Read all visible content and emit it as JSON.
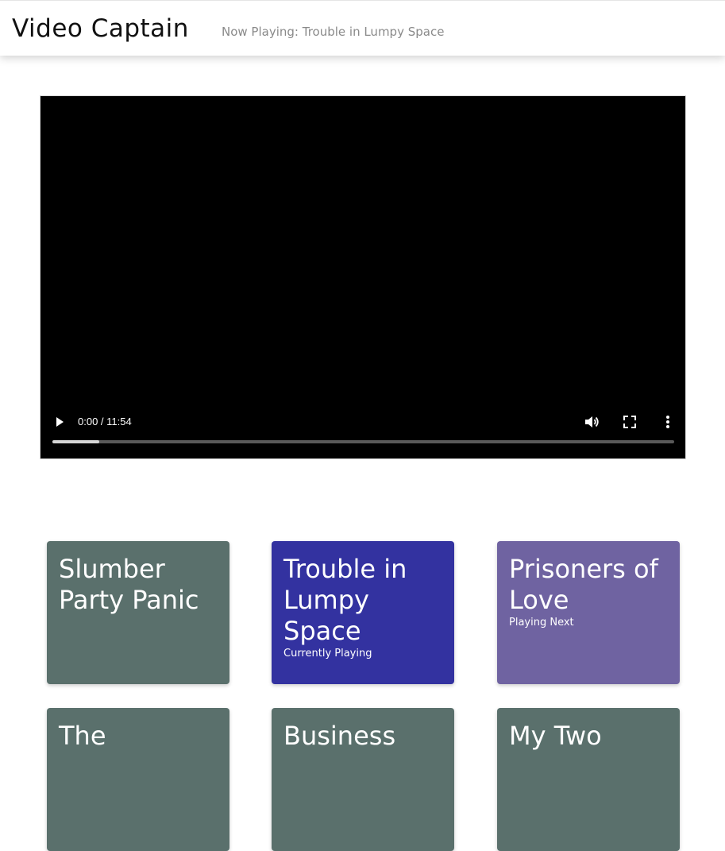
{
  "header": {
    "brand": "Video Captain",
    "now_playing": "Now Playing: Trouble in Lumpy Space"
  },
  "player": {
    "time": "0:00 / 11:54",
    "progress_fraction": 0.0,
    "buffered_fraction": 0.075,
    "icons": {
      "play": "play-icon",
      "volume": "volume-icon",
      "fullscreen": "fullscreen-icon",
      "more": "more-options-icon"
    }
  },
  "episodes": [
    {
      "title": "Slumber Party Panic",
      "status": "",
      "color": "#5a706c"
    },
    {
      "title": "Trouble in Lumpy Space",
      "status": "Currently Playing",
      "color": "#3332a0"
    },
    {
      "title": "Prisoners of Love",
      "status": "Playing Next",
      "color": "#6f63a1"
    },
    {
      "title": "The",
      "status": "",
      "color": "#5a706c"
    },
    {
      "title": "Business",
      "status": "",
      "color": "#5a706c"
    },
    {
      "title": "My Two",
      "status": "",
      "color": "#5a706c"
    }
  ]
}
